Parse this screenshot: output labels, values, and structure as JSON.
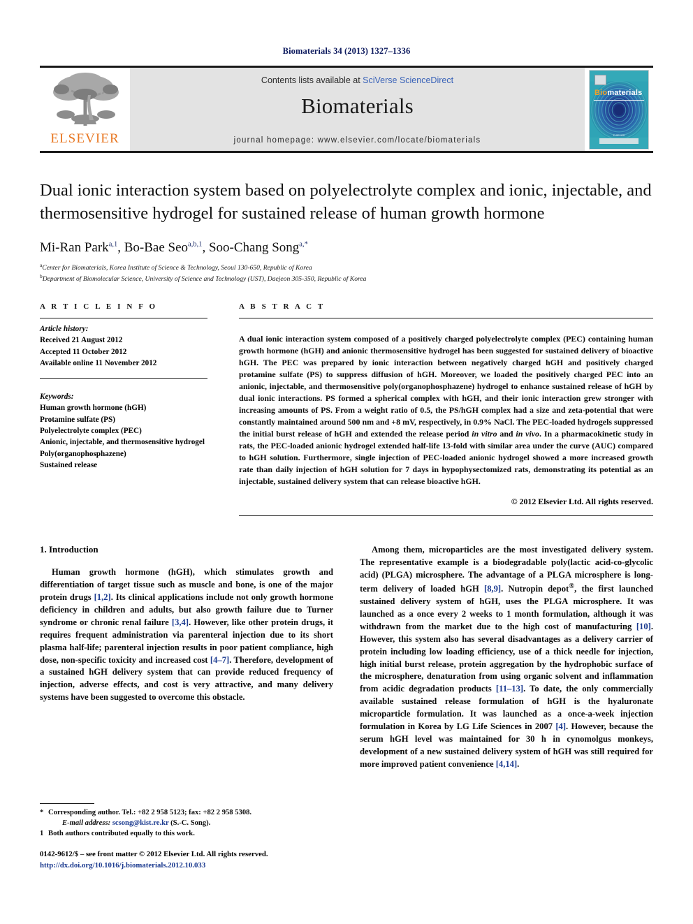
{
  "running_head": "Biomaterials 34 (2013) 1327–1336",
  "masthead": {
    "publisher_logo_label": "ELSEVIER",
    "contents_prefix": "Contents lists available at ",
    "contents_link": "SciVerse ScienceDirect",
    "journal_name": "Biomaterials",
    "homepage": "journal homepage: www.elsevier.com/locate/biomaterials",
    "cover": {
      "title_highlight": "Bio",
      "title_rest": "materials",
      "footer_caption": "ELSEVIER"
    }
  },
  "article": {
    "title": "Dual ionic interaction system based on polyelectrolyte complex and ionic, injectable, and thermosensitive hydrogel for sustained release of human growth hormone",
    "authors": [
      {
        "name": "Mi-Ran Park",
        "sup": "a,1"
      },
      {
        "name": "Bo-Bae Seo",
        "sup": "a,b,1"
      },
      {
        "name": "Soo-Chang Song",
        "sup": "a,*"
      }
    ],
    "affiliations": [
      {
        "marker": "a",
        "text": "Center for Biomaterials, Korea Institute of Science & Technology, Seoul 130-650, Republic of Korea"
      },
      {
        "marker": "b",
        "text": "Department of Biomolecular Science, University of Science and Technology (UST), Daejeon 305-350, Republic of Korea"
      }
    ]
  },
  "article_info": {
    "heading": "A R T I C L E   I N F O",
    "history_label": "Article history:",
    "history": [
      "Received 21 August 2012",
      "Accepted 11 October 2012",
      "Available online 11 November 2012"
    ],
    "keywords_label": "Keywords:",
    "keywords": [
      "Human growth hormone (hGH)",
      "Protamine sulfate (PS)",
      "Polyelectrolyte complex (PEC)",
      "Anionic, injectable, and thermosensitive hydrogel",
      "Poly(organophosphazene)",
      "Sustained release"
    ]
  },
  "abstract": {
    "heading": "A B S T R A C T",
    "text_part_1": "A dual ionic interaction system composed of a positively charged polyelectrolyte complex (PEC) containing human growth hormone (hGH) and anionic thermosensitive hydrogel has been suggested for sustained delivery of bioactive hGH. The PEC was prepared by ionic interaction between negatively charged hGH and positively charged protamine sulfate (PS) to suppress diffusion of hGH. Moreover, we loaded the positively charged PEC into an anionic, injectable, and thermosensitive poly(organophosphazene) hydrogel to enhance sustained release of hGH by dual ionic interactions. PS formed a spherical complex with hGH, and their ionic interaction grew stronger with increasing amounts of PS. From a weight ratio of 0.5, the PS/hGH complex had a size and zeta-potential that were constantly maintained around 500 nm and +8 mV, respectively, in 0.9% NaCl. The PEC-loaded hydrogels suppressed the initial burst release of hGH and extended the release period ",
    "italic_1": "in vitro",
    "text_part_2": " and ",
    "italic_2": "in vivo",
    "text_part_3": ". In a pharmacokinetic study in rats, the PEC-loaded anionic hydrogel extended half-life 13-fold with similar area under the curve (AUC) compared to hGH solution. Furthermore, single injection of PEC-loaded anionic hydrogel showed a more increased growth rate than daily injection of hGH solution for 7 days in hypophysectomized rats, demonstrating its potential as an injectable, sustained delivery system that can release bioactive hGH.",
    "copyright": "© 2012 Elsevier Ltd. All rights reserved."
  },
  "introduction": {
    "heading": "1.  Introduction",
    "left_paragraph": {
      "seg_1": "Human growth hormone (hGH), which stimulates growth and differentiation of target tissue such as muscle and bone, is one of the major protein drugs ",
      "ref_1": "[1,2]",
      "seg_2": ". Its clinical applications include not only growth hormone deficiency in children and adults, but also growth failure due to Turner syndrome or chronic renal failure ",
      "ref_2": "[3,4]",
      "seg_3": ". However, like other protein drugs, it requires frequent administration via parenteral injection due to its short plasma half-life; parenteral injection results in poor patient compliance, high dose, non-specific toxicity and increased cost ",
      "ref_3": "[4–7]",
      "seg_4": ". Therefore, development of a sustained hGH delivery system that can provide reduced frequency of injection, adverse effects, and cost is very attractive, and many delivery systems have been suggested to overcome this obstacle."
    },
    "right_paragraph": {
      "seg_1": "Among them, microparticles are the most investigated delivery system. The representative example is a biodegradable poly(lactic acid-co-glycolic acid) (PLGA) microsphere. The advantage of a PLGA microsphere is long-term delivery of loaded hGH ",
      "ref_1": "[8,9]",
      "seg_2": ". Nutropin depot",
      "sup_1": "®",
      "seg_3": ", the first launched sustained delivery system of hGH, uses the PLGA microsphere. It was launched as a once every 2 weeks to 1 month formulation, although it was withdrawn from the market due to the high cost of manufacturing ",
      "ref_2": "[10]",
      "seg_4": ". However, this system also has several disadvantages as a delivery carrier of protein including low loading efficiency, use of a thick needle for injection, high initial burst release, protein aggregation by the hydrophobic surface of the microsphere, denaturation from using organic solvent and inflammation from acidic degradation products ",
      "ref_3": "[11–13]",
      "seg_5": ". To date, the only commercially available sustained release formulation of hGH is the hyaluronate microparticle formulation. It was launched as a once-a-week injection formulation in Korea by LG Life Sciences in 2007 ",
      "ref_4": "[4]",
      "seg_6": ". However, because the serum hGH level was maintained for 30 h in cynomolgus monkeys, development of a new sustained delivery system of hGH was still required for more improved patient convenience ",
      "ref_5": "[4,14]",
      "seg_7": "."
    }
  },
  "footnotes": {
    "corresponding": {
      "marker": "*",
      "text": "Corresponding author. Tel.: +82 2 958 5123; fax: +82 2 958 5308.",
      "email_label": "E-mail address:",
      "email": "scsong@kist.re.kr",
      "email_suffix": " (S.-C. Song)."
    },
    "equal_contribution": {
      "marker": "1",
      "text": "Both authors contributed equally to this work."
    }
  },
  "page_footer": {
    "issn_line": "0142-9612/$ – see front matter © 2012 Elsevier Ltd. All rights reserved.",
    "doi": "http://dx.doi.org/10.1016/j.biomaterials.2012.10.033"
  },
  "colors": {
    "running_head": "#0d1a5e",
    "link_blue": "#1b3a8f",
    "elsevier_orange": "#e87722",
    "masthead_grey": "#e3e3e3",
    "cover_teal": "#2aa0b4"
  }
}
